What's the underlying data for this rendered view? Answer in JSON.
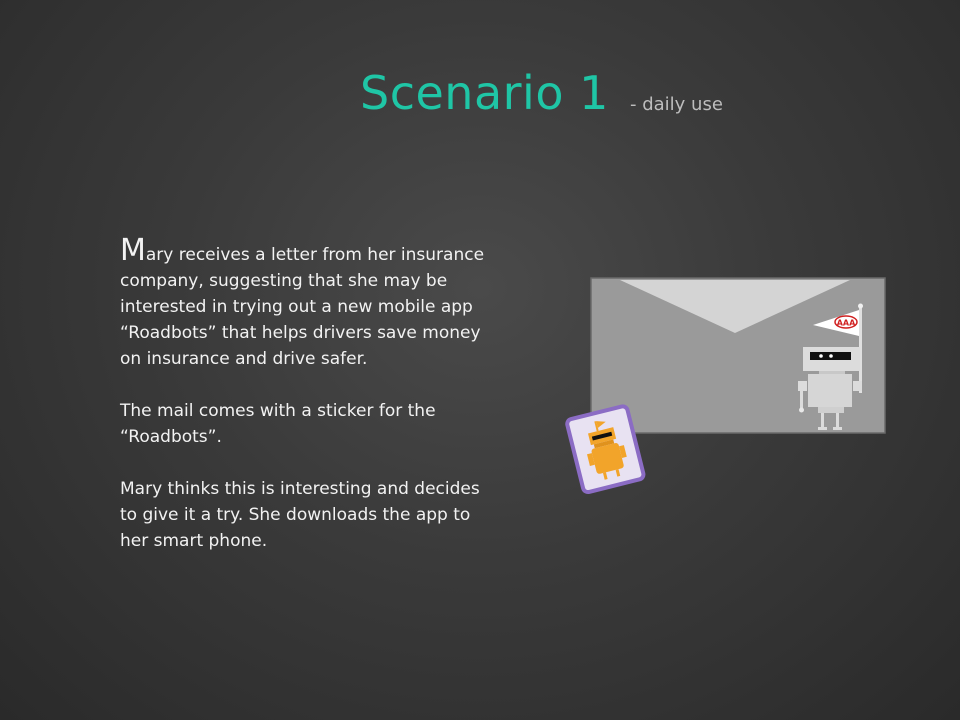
{
  "slide": {
    "title": "Scenario 1",
    "subtitle": "- daily use",
    "paragraphs": [
      {
        "dropcap": "M",
        "text": "ary receives a letter from her insurance company, suggesting that she may be interested in trying out a new mobile app “Roadbots” that helps drivers save money on insurance and drive safer."
      },
      {
        "text": "The mail comes with a sticker for the “Roadbots”."
      },
      {
        "text": "Mary thinks this is interesting and decides to give it a try. She downloads the app to her smart phone."
      }
    ],
    "flag_logo_text": "AAA"
  },
  "colors": {
    "title": "#1fc6a6",
    "subtitle": "#bdbdbd",
    "body_text": "#f2f2f2",
    "envelope": "#9a9a9a",
    "sticker_border": "#8b6cc4",
    "sticker_robot": "#f2a42a"
  },
  "icons": [
    "envelope-icon",
    "robot-icon",
    "flag-icon",
    "sticker-icon"
  ]
}
